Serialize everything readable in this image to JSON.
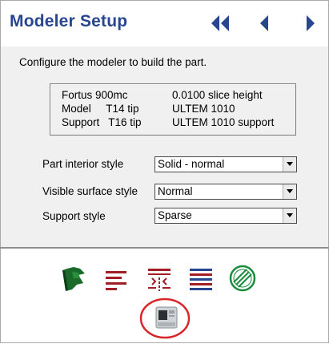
{
  "header": {
    "title": "Modeler Setup",
    "nav": [
      {
        "icon": "double-chevron-left-icon"
      },
      {
        "icon": "chevron-left-icon"
      },
      {
        "icon": "chevron-right-icon"
      }
    ],
    "accent": "#28468f"
  },
  "instruction": "Configure the modeler to build the part.",
  "info": {
    "row1": {
      "left": "Fortus 900mc",
      "right": "0.0100 slice height"
    },
    "row2": {
      "left": "Model     T14 tip",
      "right": "ULTEM 1010"
    },
    "row3": {
      "left": "Support   T16 tip",
      "right": "ULTEM 1010 support"
    }
  },
  "fields": [
    {
      "label": "Part interior style",
      "value": "Solid - normal"
    },
    {
      "label": "Visible surface style",
      "value": "Normal"
    },
    {
      "label": "Support style",
      "value": "Sparse"
    }
  ],
  "toolbar": {
    "icons": [
      "green-flag-icon",
      "lines-icon",
      "slice-arrows-icon",
      "layers-icon",
      "toolpath-icon",
      "printer-icon"
    ],
    "icon_color": "#a01e24",
    "flag_color": "#1a6b2a",
    "highlight_color": "#d8262b"
  }
}
